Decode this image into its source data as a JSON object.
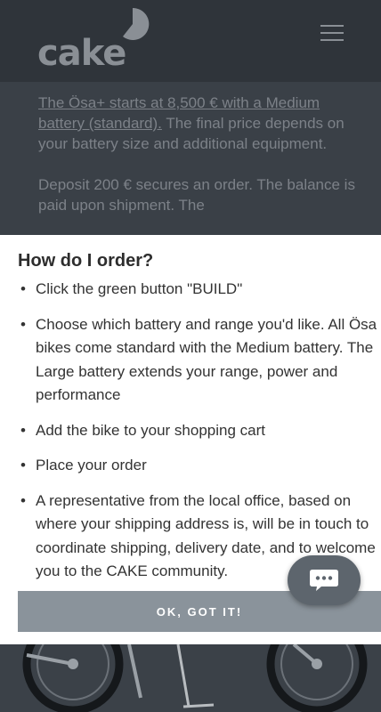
{
  "header": {
    "logo_text": "cake",
    "menu_icon": "hamburger-menu-icon"
  },
  "intro": {
    "link_text": "The Ösa+ starts at 8,500 € with a Medium battery (standard).",
    "sentence_rest": " The final price depends on your battery size and additional equipment.",
    "deposit_text": "Deposit 200 € secures an order. The balance is paid upon shipment. The"
  },
  "modal": {
    "title": "How do I order?",
    "items": [
      "Click the green button \"BUILD\"",
      "Choose which battery and range you'd like. All Ösa bikes come standard with the Medium battery. The Large battery extends your range, power and performance",
      "Add the bike to your shopping cart",
      "Place your order",
      "A representative from the local office, based on where your shipping address is, will be in touch to coordinate shipping, delivery date, and to welcome you to the CAKE community."
    ],
    "ok_label": "OK, GOT IT!"
  },
  "chat": {
    "icon": "chat-bubble-icon"
  },
  "colors": {
    "overlay_bg": "#3a4047",
    "modal_bg": "#ffffff",
    "button_bg": "#8a939b",
    "chat_bg": "#5d656d"
  }
}
